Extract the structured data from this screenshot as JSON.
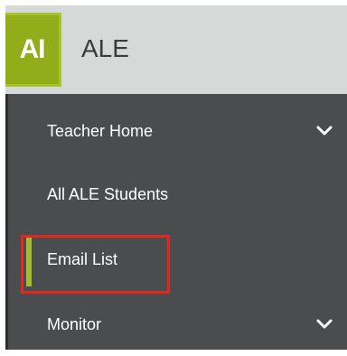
{
  "header": {
    "logo_text": "AI",
    "title": "ALE"
  },
  "sidebar": {
    "items": [
      {
        "label": "Teacher Home",
        "has_chevron": true,
        "icon": "chevron-down-icon"
      },
      {
        "label": "All ALE Students",
        "has_chevron": false
      },
      {
        "label": "Email List",
        "has_chevron": false,
        "active": true,
        "highlighted": true
      },
      {
        "label": "Monitor",
        "has_chevron": true,
        "icon": "chevron-down-icon"
      }
    ]
  },
  "colors": {
    "header_bg": "#d7d8d8",
    "logo_bg": "#93ad1a",
    "sidebar_bg": "#4b4c4e",
    "accent": "#a3bd2a",
    "highlight": "#e3261f",
    "nav_text": "#ffffff"
  }
}
